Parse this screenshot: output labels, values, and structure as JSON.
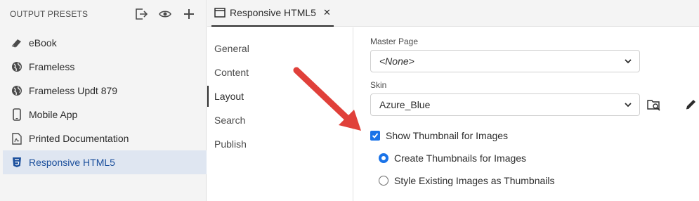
{
  "left_panel": {
    "title": "OUTPUT PRESETS",
    "header_icons": [
      "export-icon",
      "eye-icon",
      "plus-icon"
    ],
    "presets": [
      {
        "label": "eBook",
        "icon": "ebook-icon",
        "selected": false
      },
      {
        "label": "Frameless",
        "icon": "globe-icon",
        "selected": false
      },
      {
        "label": "Frameless Updt 879",
        "icon": "globe-icon",
        "selected": false
      },
      {
        "label": "Mobile App",
        "icon": "mobile-icon",
        "selected": false
      },
      {
        "label": "Printed Documentation",
        "icon": "pdf-icon",
        "selected": false
      },
      {
        "label": "Responsive HTML5",
        "icon": "html5-icon",
        "selected": true
      }
    ]
  },
  "tab": {
    "label": "Responsive HTML5",
    "close": "✕"
  },
  "subnav": {
    "items": [
      {
        "label": "General",
        "active": false
      },
      {
        "label": "Content",
        "active": false
      },
      {
        "label": "Layout",
        "active": true
      },
      {
        "label": "Search",
        "active": false
      },
      {
        "label": "Publish",
        "active": false
      }
    ]
  },
  "layout": {
    "master_page_label": "Master Page",
    "master_page_value": "<None>",
    "skin_label": "Skin",
    "skin_value": "Azure_Blue",
    "show_thumbnail_label": "Show Thumbnail for Images",
    "show_thumbnail_checked": true,
    "radio_create_label": "Create Thumbnails for Images",
    "radio_style_label": "Style Existing Images as Thumbnails",
    "radio_selected": "create"
  },
  "colors": {
    "accent": "#1a73e8",
    "selected_bg": "#dfe6f1",
    "arrow": "#e0403a"
  }
}
